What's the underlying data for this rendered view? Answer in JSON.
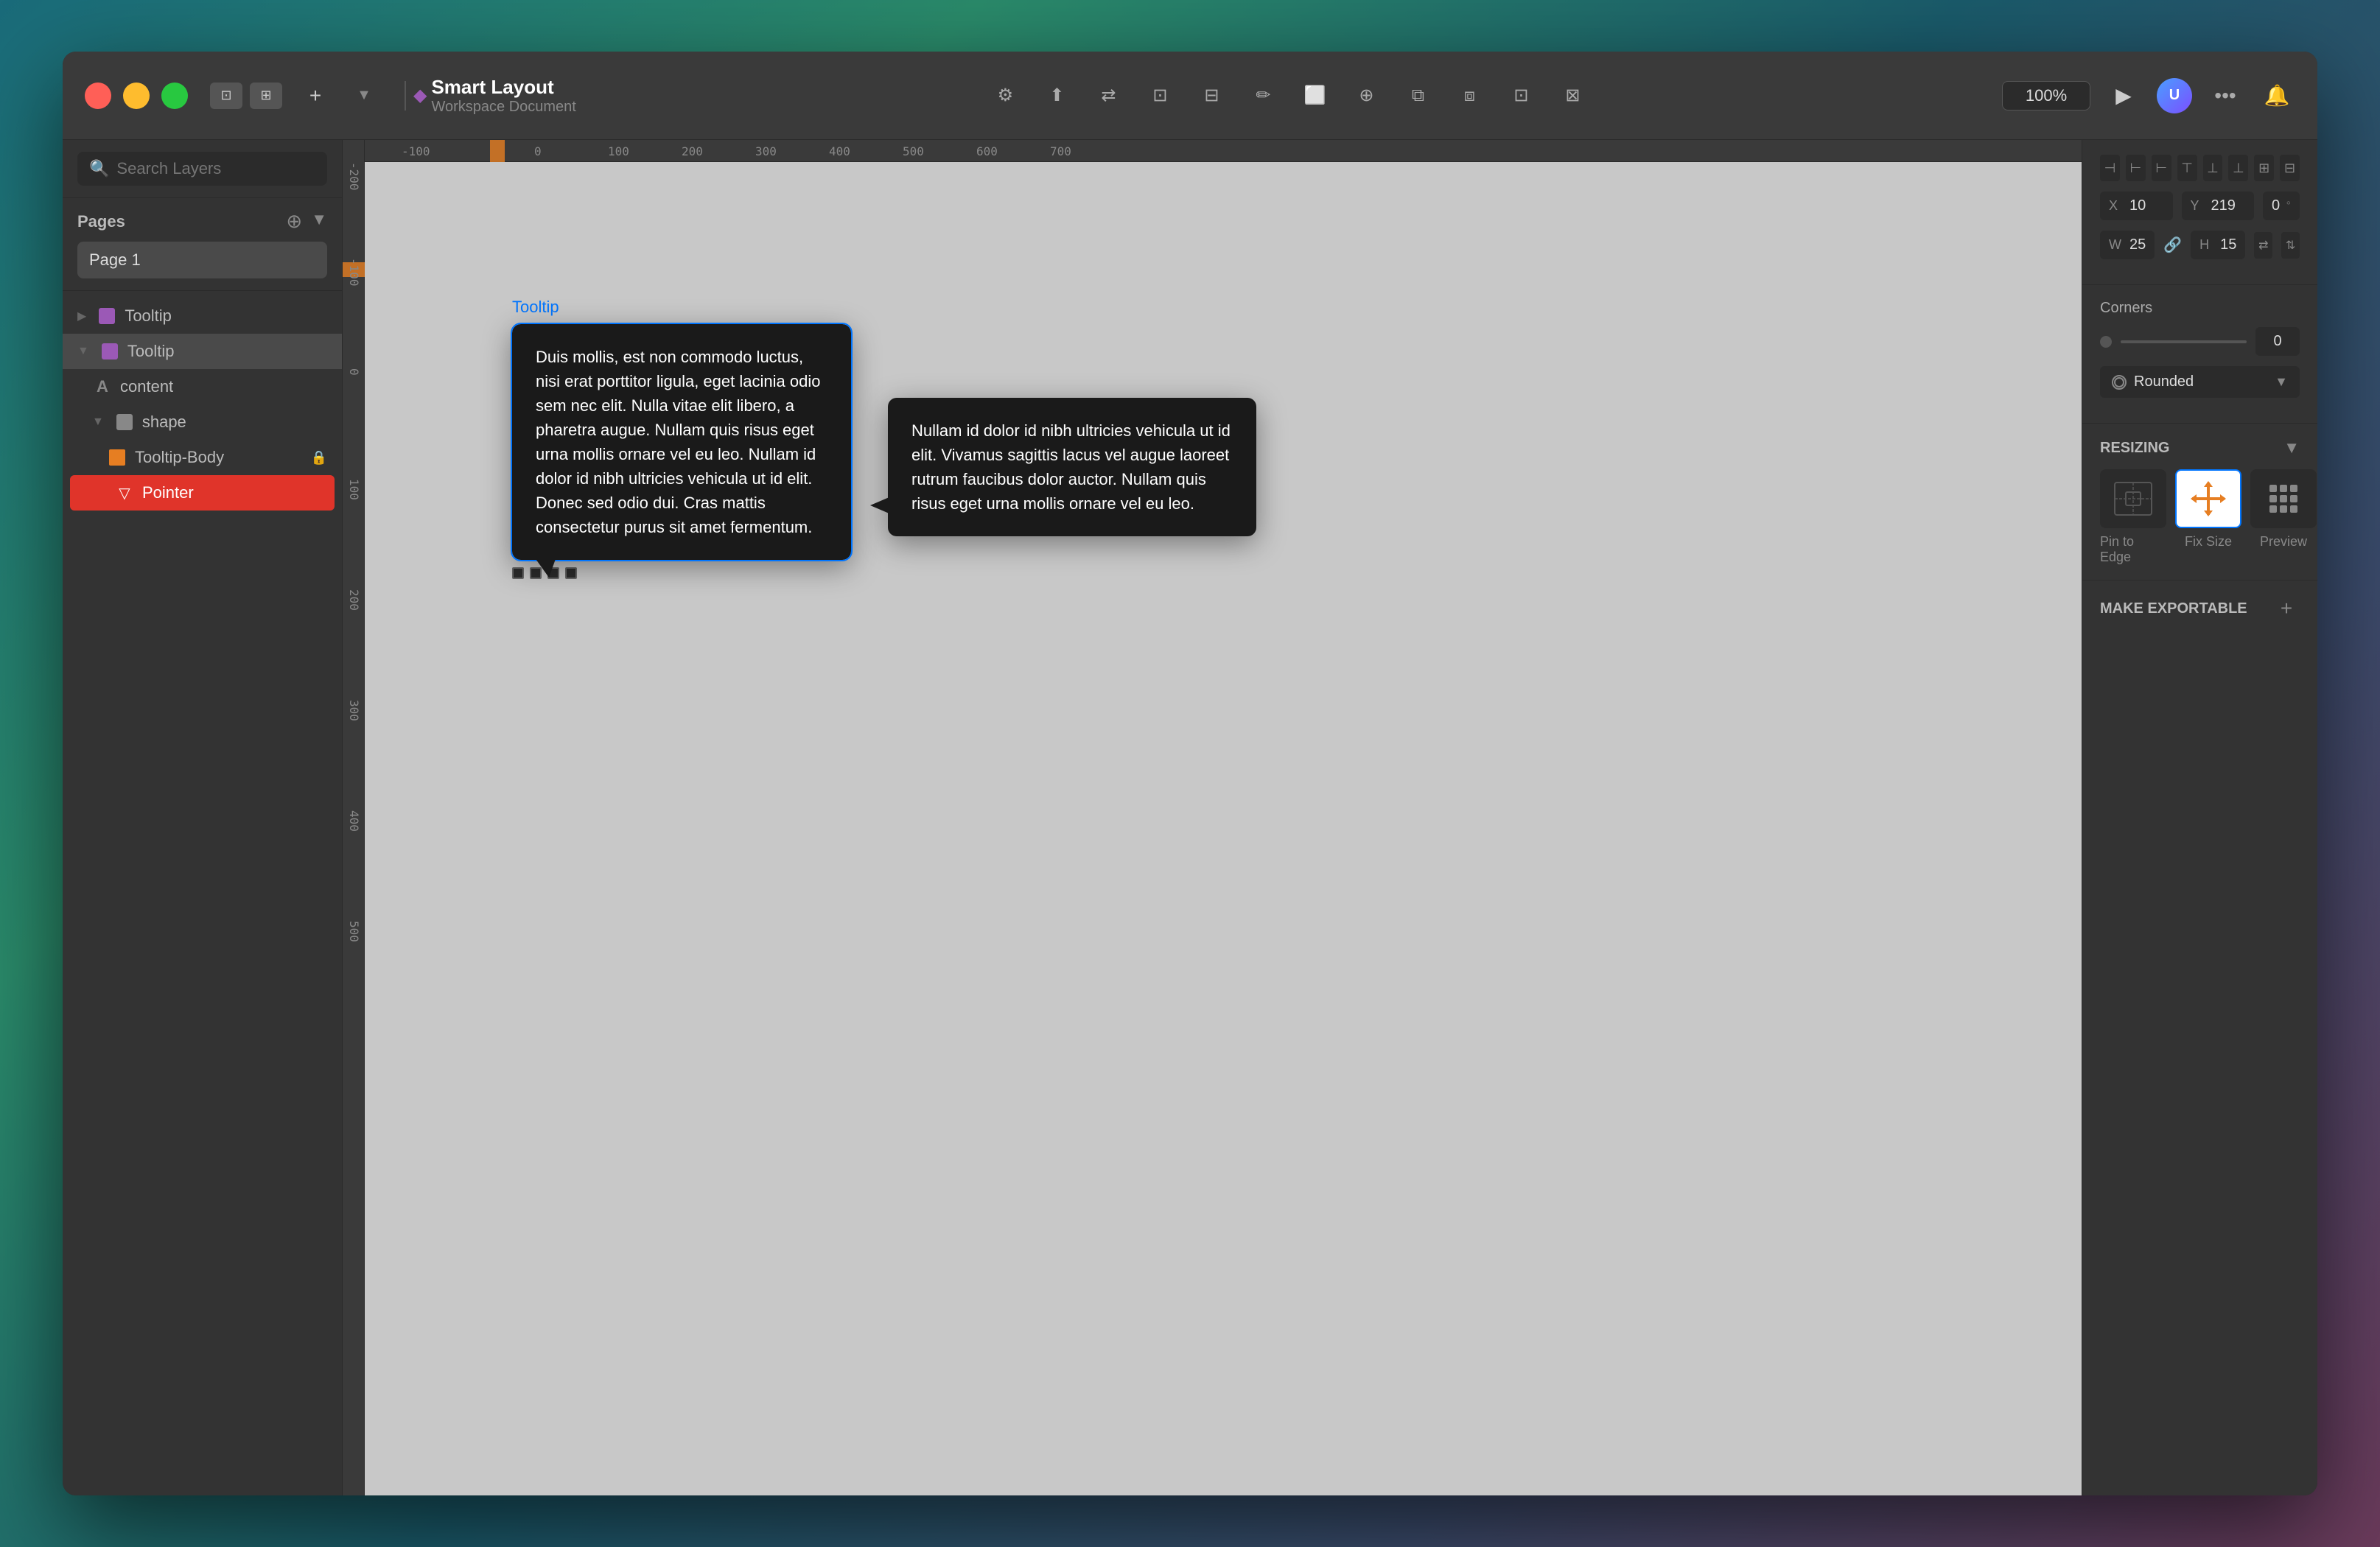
{
  "app": {
    "title": "Smart Layout",
    "subtitle": "Workspace Document",
    "zoom": "100%"
  },
  "titlebar": {
    "add_label": "+",
    "close_label": "▼"
  },
  "sidebar": {
    "search_placeholder": "Search Layers",
    "pages_label": "Pages",
    "page_item": "Page 1",
    "layers": [
      {
        "label": "Tooltip",
        "level": 0,
        "type": "component",
        "collapsed": true,
        "id": "tooltip-1"
      },
      {
        "label": "Tooltip",
        "level": 0,
        "type": "component",
        "expanded": true,
        "id": "tooltip-2"
      },
      {
        "label": "content",
        "level": 1,
        "type": "text",
        "id": "content"
      },
      {
        "label": "shape",
        "level": 1,
        "type": "group",
        "expanded": true,
        "id": "shape"
      },
      {
        "label": "Tooltip-Body",
        "level": 2,
        "type": "rect",
        "id": "tooltip-body"
      },
      {
        "label": "Pointer",
        "level": 2,
        "type": "pointer",
        "active": true,
        "id": "pointer"
      }
    ]
  },
  "canvas": {
    "tooltip1": {
      "label": "Tooltip",
      "text": "Duis mollis, est non commodo luctus, nisi erat porttitor ligula, eget lacinia odio sem nec elit. Nulla vitae elit libero, a pharetra augue. Nullam quis risus eget urna mollis ornare vel eu leo. Nullam id dolor id nibh ultricies vehicula ut id elit. Donec sed odio dui. Cras mattis consectetur purus sit amet fermentum."
    },
    "tooltip2": {
      "text": "Nullam id dolor id nibh ultricies vehicula ut id elit. Vivamus sagittis lacus vel augue laoreet rutrum faucibus dolor auctor. Nullam quis risus eget urna mollis ornare vel eu leo."
    }
  },
  "right_panel": {
    "x_label": "X",
    "y_label": "Y",
    "w_label": "W",
    "h_label": "H",
    "x_value": "10",
    "y_value": "219",
    "w_value": "25",
    "h_value": "15",
    "rotation_value": "0",
    "corners_label": "Corners",
    "corners_value": "0",
    "corner_type": "Rounded",
    "resizing_label": "RESIZING",
    "pin_to_edge_label": "Pin to Edge",
    "fix_size_label": "Fix Size",
    "preview_label": "Preview",
    "make_exportable_label": "MAKE EXPORTABLE"
  }
}
